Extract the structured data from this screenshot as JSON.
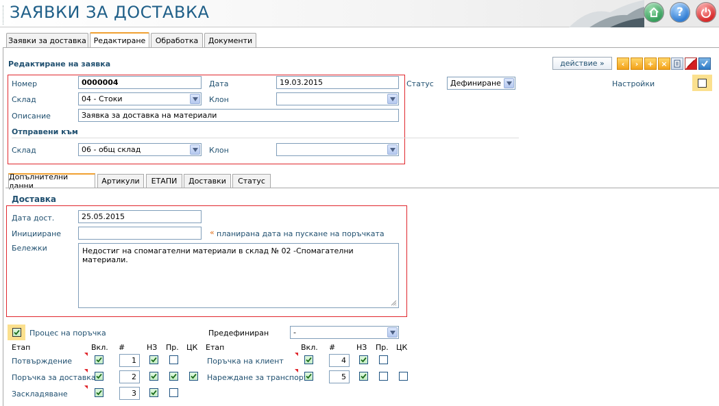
{
  "app": {
    "title": "ЗАЯВКИ ЗА ДОСТАВКА"
  },
  "main_tabs": [
    {
      "label": "Заявки за доставка"
    },
    {
      "label": "Редактиране"
    },
    {
      "label": "Обработка"
    },
    {
      "label": "Документи"
    }
  ],
  "header_icons": [
    "home-icon",
    "help-icon",
    "power-icon"
  ],
  "edit_section": {
    "title": "Редактиране на заявка",
    "action_label": "действие »",
    "number_label": "Номер",
    "number_value": "0000004",
    "date_label": "Дата",
    "date_value": "19.03.2015",
    "status_label": "Статус",
    "status_value": "Дефиниране",
    "warehouse_label": "Склад",
    "warehouse_value": "04 - Стоки",
    "branch_label": "Клон",
    "branch_value": "",
    "description_label": "Описание",
    "description_value": "Заявка за доставка на материали",
    "sent_to_title": "Отправени към",
    "sent_warehouse_label": "Склад",
    "sent_warehouse_value": "06 - общ склад",
    "sent_branch_label": "Клон",
    "sent_branch_value": "",
    "settings_label": "Настройки"
  },
  "sub_tabs": [
    {
      "label": "Допълнителни данни"
    },
    {
      "label": "Артикули"
    },
    {
      "label": "ЕТАПИ"
    },
    {
      "label": "Доставки"
    },
    {
      "label": "Статус"
    }
  ],
  "delivery": {
    "title": "Доставка",
    "delivery_date_label": "Дата дост.",
    "delivery_date_value": "25.05.2015",
    "initiation_label": "Иницииране",
    "initiation_value": "",
    "initiation_hint": "планирана дата на пускане на поръчката",
    "notes_label": "Бележки",
    "notes_value": "Недостиг на спомагателни материали в склад № 02 -Спомагателни материали."
  },
  "process": {
    "checkbox_label": "Процес на поръчка",
    "checked": true,
    "predefined_label": "Предефиниран",
    "predefined_value": "-",
    "headers": {
      "stage": "Етап",
      "incl": "Вкл.",
      "num": "#",
      "nz": "НЗ",
      "pr": "Пр.",
      "ck": "ЦК"
    },
    "left_stages": [
      {
        "name": "Потвърждение",
        "incl": true,
        "num": "1",
        "nz": true,
        "pr": false,
        "ck": null
      },
      {
        "name": "Поръчка за доставка",
        "incl": true,
        "num": "2",
        "nz": true,
        "pr": true,
        "ck": true
      },
      {
        "name": "Заскладяване",
        "incl": true,
        "num": "3",
        "nz": true,
        "pr": false,
        "ck": null
      }
    ],
    "right_stages": [
      {
        "name": "Поръчка на клиент",
        "incl": true,
        "num": "4",
        "nz": true,
        "pr": false,
        "ck": null
      },
      {
        "name": "Нареждане за транспорт",
        "incl": true,
        "num": "5",
        "nz": true,
        "pr": false,
        "ck": false
      }
    ]
  }
}
